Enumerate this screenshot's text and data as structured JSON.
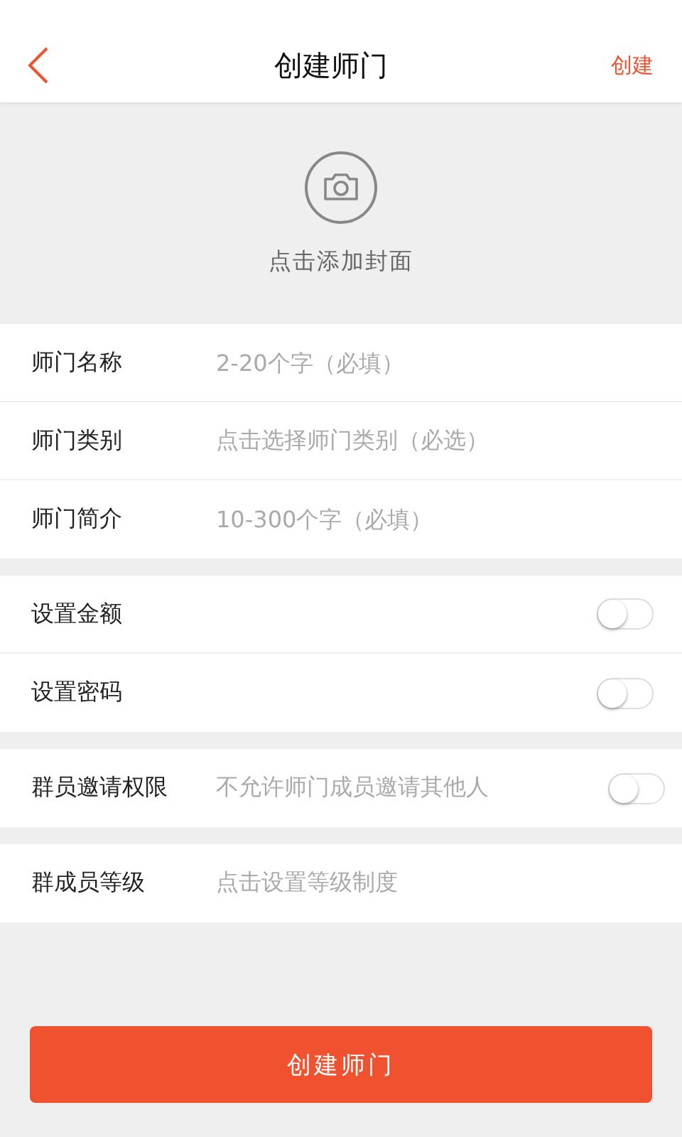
{
  "header": {
    "title": "创建师门",
    "action": "创建"
  },
  "cover": {
    "label": "点击添加封面"
  },
  "groups": [
    [
      {
        "kind": "input",
        "label": "师门名称",
        "placeholder": "2-20个字（必填）"
      },
      {
        "kind": "select",
        "label": "师门类别",
        "placeholder": "点击选择师门类别（必选）"
      },
      {
        "kind": "input",
        "label": "师门简介",
        "placeholder": "10-300个字（必填）"
      }
    ],
    [
      {
        "kind": "toggle",
        "label": "设置金额",
        "on": false
      },
      {
        "kind": "toggle",
        "label": "设置密码",
        "on": false
      }
    ],
    [
      {
        "kind": "hint_toggle",
        "label": "群员邀请权限",
        "hint": "不允许师门成员邀请其他人",
        "on": false
      }
    ],
    [
      {
        "kind": "select",
        "label": "群成员等级",
        "placeholder": "点击设置等级制度"
      }
    ]
  ],
  "submit": "创建师门"
}
